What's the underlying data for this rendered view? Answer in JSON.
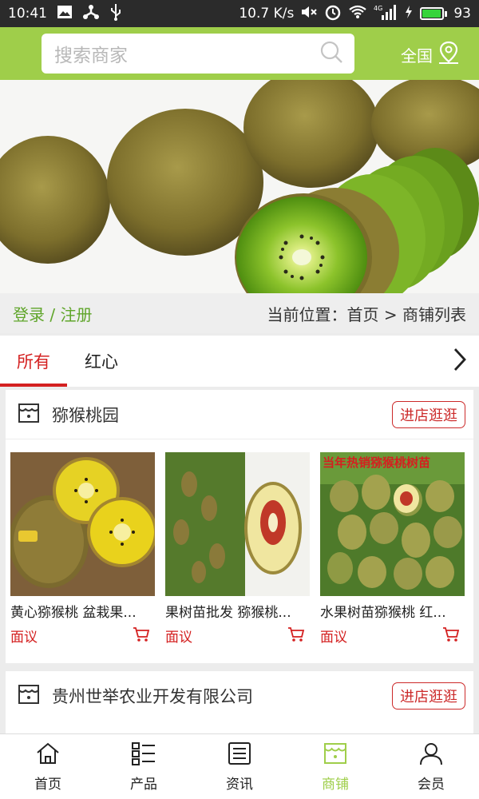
{
  "status_bar": {
    "time": "10:41",
    "network_speed": "10.7 K/s",
    "network_type": "4G",
    "battery": "93",
    "battery_level": 0.93,
    "icons": [
      "image-icon",
      "usb-debug-icon",
      "usb-icon",
      "mute-icon",
      "alarm-icon",
      "wifi-icon",
      "signal-icon",
      "charging-icon",
      "battery-icon"
    ]
  },
  "header": {
    "search_placeholder": "搜索商家",
    "region_label": "全国",
    "accent_color": "#9fce4a"
  },
  "location_bar": {
    "login_label": "登录 / 注册",
    "location_label": "当前位置：首页 > 商铺列表"
  },
  "tabs": [
    {
      "label": "所有",
      "active": true
    },
    {
      "label": "红心",
      "active": false
    }
  ],
  "shops": [
    {
      "name": "猕猴桃园",
      "enter_label": "进店逛逛",
      "products": [
        {
          "title": "黄心猕猴桃 盆栽果...",
          "price": "面议"
        },
        {
          "title": "果树苗批发 猕猴桃...",
          "price": "面议"
        },
        {
          "title": "水果树苗猕猴桃 红...",
          "price": "面议",
          "image_caption": "当年热销猕猴桃树苗"
        }
      ]
    },
    {
      "name": "贵州世举农业开发有限公司",
      "enter_label": "进店逛逛"
    }
  ],
  "bottom_nav": [
    {
      "label": "首页",
      "icon": "home-icon",
      "active": false
    },
    {
      "label": "产品",
      "icon": "list-icon",
      "active": false
    },
    {
      "label": "资讯",
      "icon": "news-icon",
      "active": false
    },
    {
      "label": "商铺",
      "icon": "store-icon",
      "active": true
    },
    {
      "label": "会员",
      "icon": "user-icon",
      "active": false
    }
  ],
  "colors": {
    "accent": "#9fce4a",
    "highlight_red": "#d42020",
    "login_green": "#5fa52a"
  }
}
